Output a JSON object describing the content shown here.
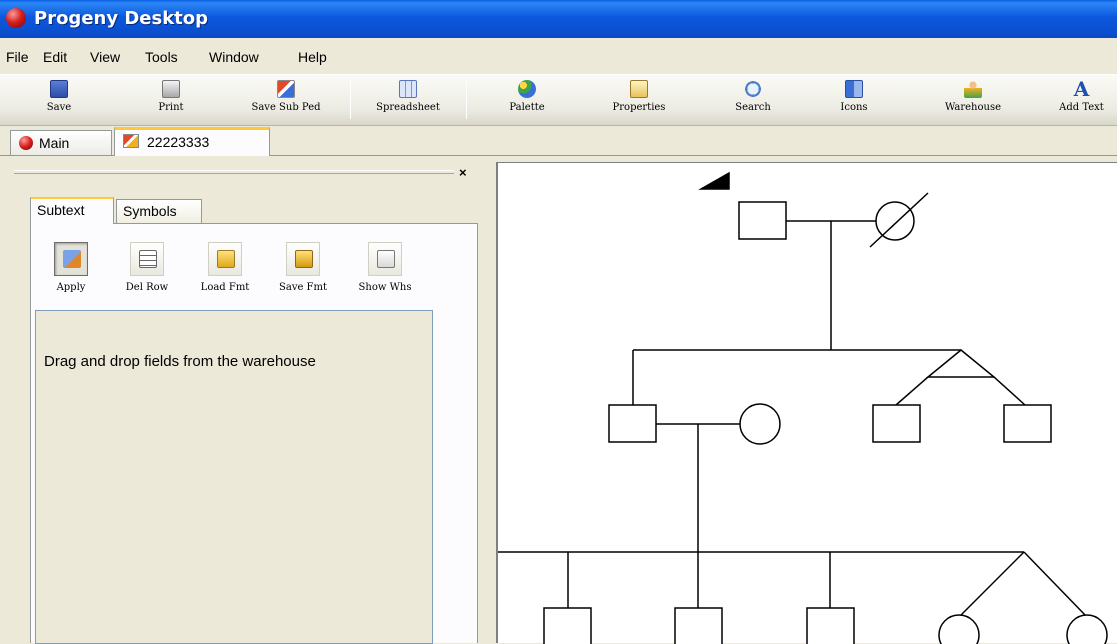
{
  "window": {
    "title": "Progeny Desktop",
    "icon": "progeny-app-icon"
  },
  "menu": [
    "File",
    "Edit",
    "View",
    "Tools",
    "Window",
    "Help"
  ],
  "toolbar": {
    "save": "Save",
    "print": "Print",
    "save_sub_ped": "Save Sub Ped",
    "spreadsheet": "Spreadsheet",
    "palette": "Palette",
    "properties": "Properties",
    "search": "Search",
    "icons": "Icons",
    "warehouse": "Warehouse",
    "add_text": "Add Text"
  },
  "doc_tabs": {
    "main": "Main",
    "pedigree": "22223333"
  },
  "left_pane": {
    "close_symbol": "×",
    "tabs": {
      "subtext": "Subtext",
      "symbols": "Symbols"
    },
    "buttons": {
      "apply": "Apply",
      "del_row": "Del Row",
      "load_fmt": "Load Fmt",
      "save_fmt": "Save Fmt",
      "show_whs": "Show Whs"
    },
    "drop_hint": "Drag and drop fields from the warehouse"
  },
  "colors": {
    "title_blue": "#0a54d8",
    "tab_highlight": "#ffc83c",
    "app_red": "#d42020"
  }
}
